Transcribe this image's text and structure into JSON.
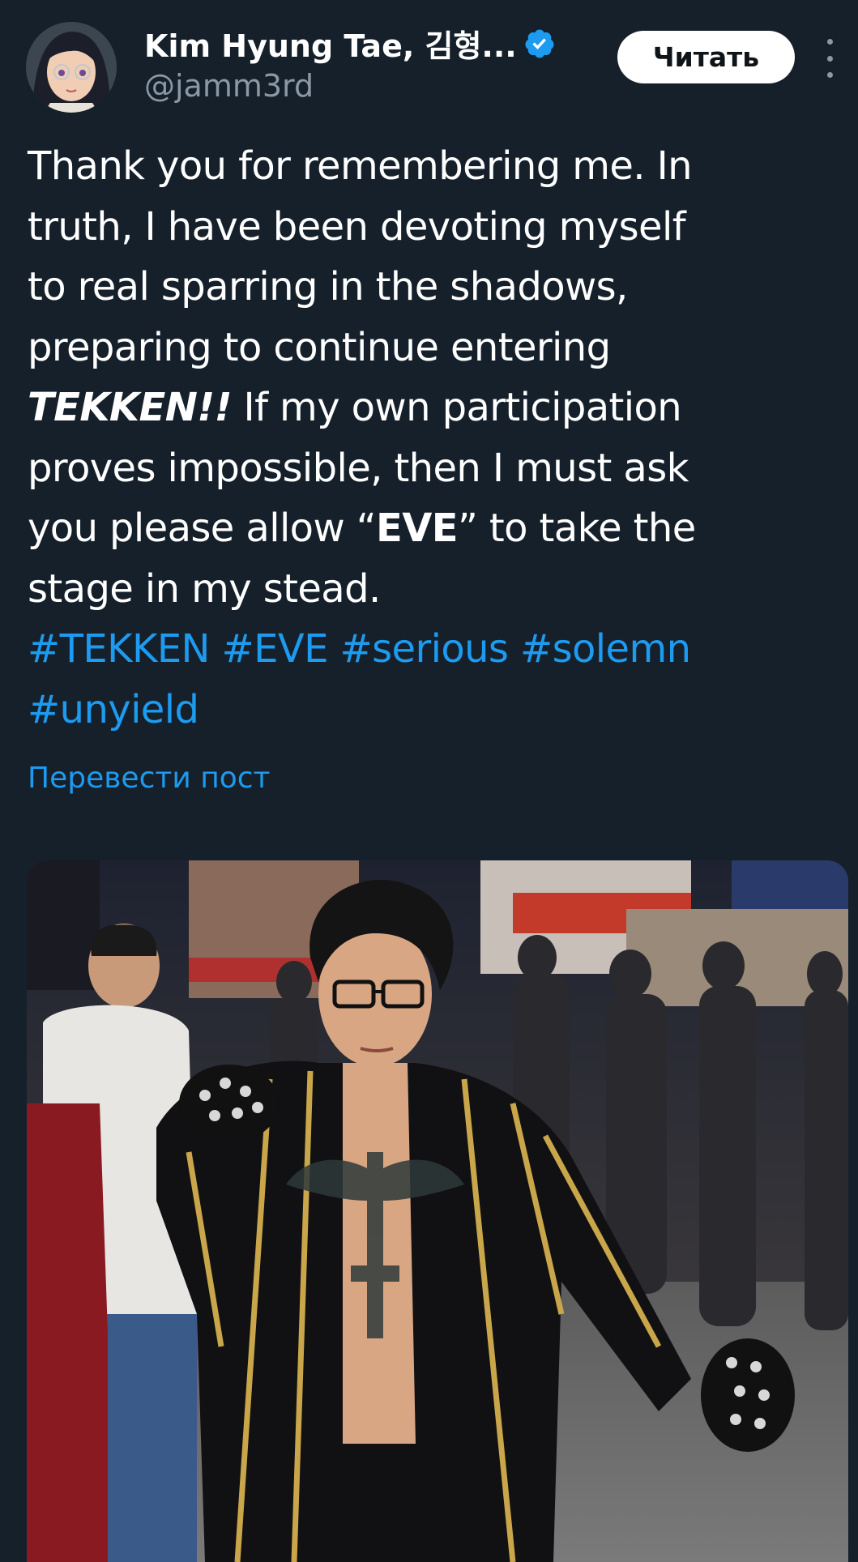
{
  "user": {
    "display_name": "Kim Hyung Tae, 김형...",
    "handle": "@jamm3rd",
    "verified": true,
    "avatar_icon": "anime-avatar-glasses",
    "verified_icon": "verified-badge-icon"
  },
  "actions": {
    "follow_label": "Читать",
    "more_icon": "more-vertical-icon"
  },
  "post": {
    "lines": [
      "Thank you for remembering me. In",
      "truth, I have been devoting myself",
      "to real sparring in the shadows,",
      "preparing to continue entering"
    ],
    "line5_emph": "TEKKEN!!",
    "line5_rest": " If my own participation",
    "line6": "proves impossible, then I must ask",
    "line7_a": "you please allow “",
    "line7_bold": "EVE",
    "line7_b": "” to take the",
    "line8": "stage in my stead.",
    "hashtags_line1": [
      "#TEKKEN",
      "#EVE",
      "#serious",
      "#solemn"
    ],
    "hashtags_line2": [
      "#unyield"
    ],
    "translate_label": "Перевести пост"
  },
  "colors": {
    "background": "#15202b",
    "link": "#1d9bf0",
    "secondary_text": "#8b98a5",
    "primary_text": "#ffffff"
  }
}
